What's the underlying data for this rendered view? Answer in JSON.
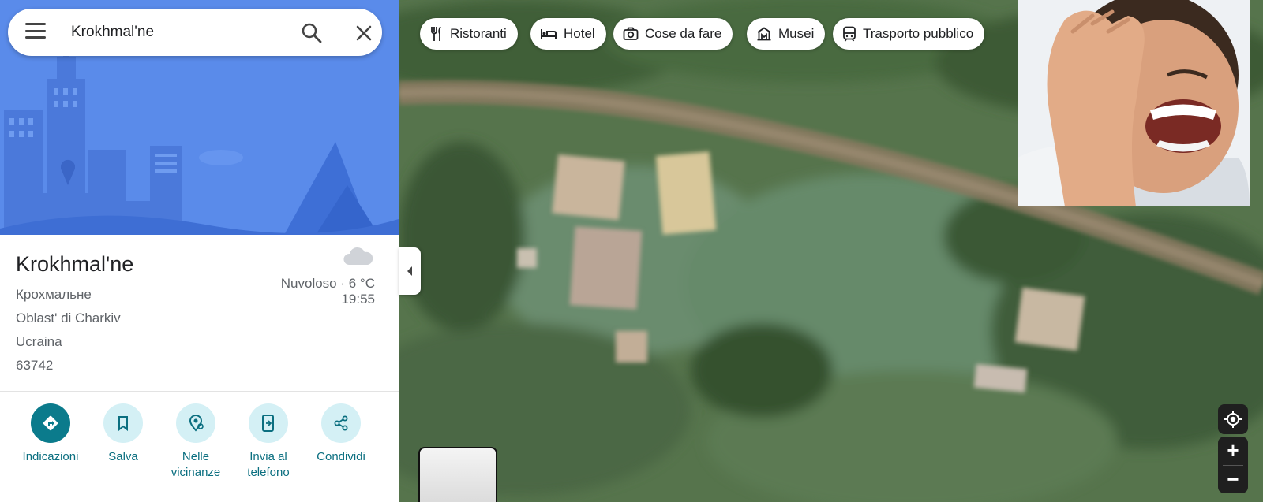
{
  "search": {
    "value": "Krokhmal'ne"
  },
  "place": {
    "title": "Krokhmal'ne",
    "address_lines": [
      "Крохмальне",
      "Oblast' di Charkiv",
      "Ucraina",
      "63742"
    ],
    "weather": "Nuvoloso · 6 °C",
    "time": "19:55"
  },
  "actions": [
    {
      "label": "Indicazioni",
      "icon": "directions-icon"
    },
    {
      "label": "Salva",
      "icon": "bookmark-icon"
    },
    {
      "label": "Nelle vicinanze",
      "icon": "nearby-icon"
    },
    {
      "label": "Invia al telefono",
      "icon": "send-to-phone-icon"
    },
    {
      "label": "Condividi",
      "icon": "share-icon"
    }
  ],
  "chips": [
    {
      "label": "Ristoranti",
      "icon": "restaurant-icon"
    },
    {
      "label": "Hotel",
      "icon": "hotel-icon"
    },
    {
      "label": "Cose da fare",
      "icon": "camera-icon"
    },
    {
      "label": "Musei",
      "icon": "museum-icon"
    },
    {
      "label": "Trasporto pubblico",
      "icon": "transit-icon"
    }
  ],
  "colors": {
    "primary": "#0b7b8c",
    "action_bg": "#d4f0f5",
    "hero": "#5c8cea"
  }
}
